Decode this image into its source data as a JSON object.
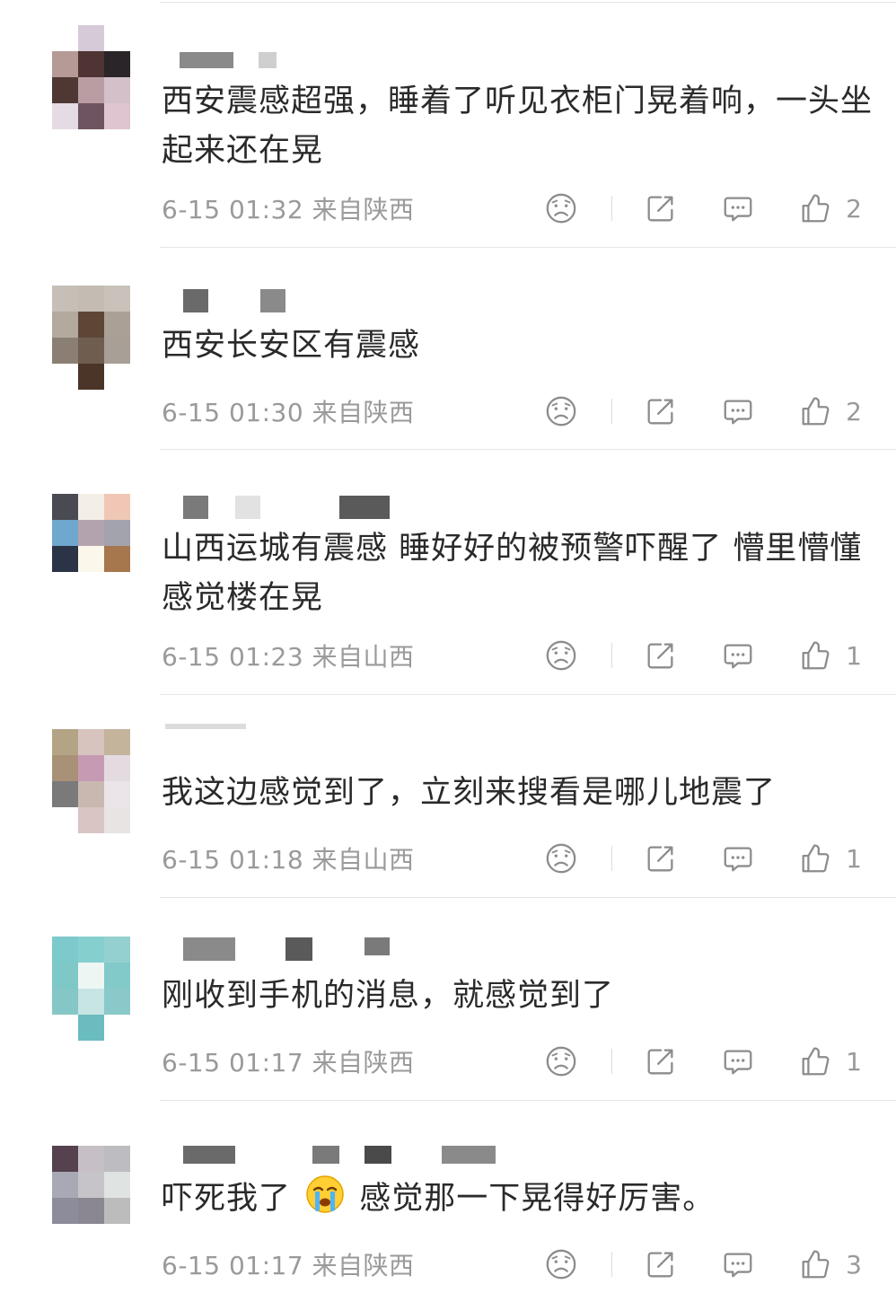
{
  "comments": [
    {
      "text": "西安震感超强，睡着了听见衣柜门晃着响，一头坐起来还在晃",
      "time": "6-15 01:32",
      "location": "来自陕西",
      "likes": "2",
      "avatar_colors": [
        "#ffffff",
        "#d6cad8",
        "#ffffff",
        "#b59a96",
        "#4e3533",
        "#2a2528",
        "#4f3834",
        "#b89ea3",
        "#d3c0c8",
        "#e4dbe4",
        "#6e5360",
        "#dec5d0"
      ]
    },
    {
      "text": "西安长安区有震感",
      "time": "6-15 01:30",
      "location": "来自陕西",
      "likes": "2",
      "avatar_colors": [
        "#c6bfb8",
        "#c4bcb3",
        "#c8c2ba",
        "#b3a99d",
        "#5e4637",
        "#aba095",
        "#8a7f72",
        "#6f5e4f",
        "#a89f96",
        "#ffffff",
        "#4a3528",
        "#ffffff"
      ]
    },
    {
      "text_before": "山西运城有震感  睡好好的被预警吓醒了 懵里懵懂感觉楼在晃",
      "time": "6-15 01:23",
      "location": "来自山西",
      "likes": "1",
      "avatar_colors": [
        "#4a4a52",
        "#f3eee6",
        "#f0c7b5",
        "#6fa7cf",
        "#b3a3ae",
        "#a3a3ae",
        "#2a3446",
        "#fbf7ea",
        "#a6764c",
        "#ffffff",
        "#ffffff",
        "#ffffff"
      ]
    },
    {
      "text": "我这边感觉到了，立刻来搜看是哪儿地震了",
      "time": "6-15 01:18",
      "location": "来自山西",
      "likes": "1",
      "avatar_colors": [
        "#b4a486",
        "#d8c4bf",
        "#c4b49c",
        "#a99178",
        "#c79ab4",
        "#e4dbe1",
        "#7a7a7a",
        "#c9b8b0",
        "#ebe4e8",
        "#ffffff",
        "#d8c5c4",
        "#e8e4e4"
      ]
    },
    {
      "text": "刚收到手机的消息，就感觉到了",
      "time": "6-15 01:17",
      "location": "来自陕西",
      "likes": "1",
      "avatar_colors": [
        "#7ccacb",
        "#86cfcf",
        "#95d0d0",
        "#7fc8c8",
        "#eef6f4",
        "#82c9c9",
        "#85c6c7",
        "#c7e5e3",
        "#8ac9c9",
        "#ffffff",
        "#6bbcbe",
        "#ffffff"
      ]
    },
    {
      "text_before": "吓死我了",
      "text_after": "感觉那一下晃得好厉害。",
      "emoji_name": "crying-emoji",
      "time": "6-15 01:17",
      "location": "来自陕西",
      "likes": "3",
      "avatar_colors": [
        "#56414e",
        "#c6c0c6",
        "#bdbcc0",
        "#a8a9b4",
        "#c6c4c9",
        "#dfe3e2",
        "#8c8c9b",
        "#8a8790",
        "#bcbcbc",
        "#ffffff",
        "#ffffff",
        "#ffffff"
      ]
    }
  ],
  "icons": {
    "dislike": "sad-face-icon",
    "share": "share-icon",
    "reply": "comment-bubble-icon",
    "like": "thumbs-up-icon"
  },
  "colors": {
    "text": "#2a2a2a",
    "meta": "#9a9a9a",
    "icon": "#8c8c8c",
    "divider": "#e6e6e6"
  }
}
